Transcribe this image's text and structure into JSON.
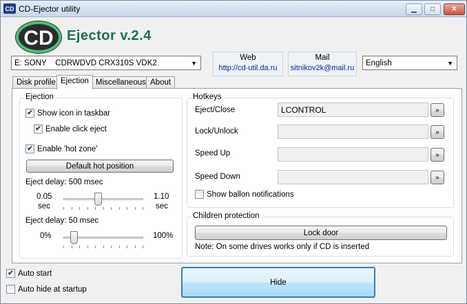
{
  "window": {
    "icon_text": "CD",
    "title": "CD-Ejector utility",
    "minimize_glyph": "▁",
    "maximize_glyph": "□",
    "close_glyph": "✕"
  },
  "header": {
    "logo_text": "CD",
    "brand": "Ejector v.2.4",
    "logo_colors": {
      "ring": "#4cc07a",
      "letters": "#ffffff",
      "disc": "#2c2c2c"
    }
  },
  "drive_select": {
    "value": "E: SONY    CDRWDVD CRX310S VDK2"
  },
  "web": {
    "label": "Web",
    "url": "http://cd-util.da.ru"
  },
  "mail": {
    "label": "Mail",
    "address": "sitnikov2k@mail.ru"
  },
  "language_select": {
    "value": "English"
  },
  "tabs": [
    {
      "label": "Disk profile"
    },
    {
      "label": "Ejection"
    },
    {
      "label": "Miscellaneous"
    },
    {
      "label": "About"
    }
  ],
  "ejection": {
    "title": "Ejection",
    "show_icon": {
      "label": "Show icon in taskbar",
      "checked": true
    },
    "enable_click": {
      "label": "Enable click eject",
      "checked": true
    },
    "hot_zone": {
      "label": "Enable 'hot zone'",
      "checked": true
    },
    "default_hot_button": "Default hot position",
    "delay1": {
      "label": "Eject delay: 500 msec",
      "min_value": "0.05",
      "min_unit": "sec",
      "max_value": "1.10",
      "max_unit": "sec",
      "position": 0.43
    },
    "delay2": {
      "label": "Eject delay: 50 msec",
      "min_label": "0%",
      "max_label": "100%",
      "position": 0.13
    }
  },
  "hotkeys": {
    "title": "Hotkeys",
    "rows": [
      {
        "label": "Eject/Close",
        "value": "LCONTROL",
        "button": "»"
      },
      {
        "label": "Lock/Unlock",
        "value": "",
        "button": "»"
      },
      {
        "label": "Speed Up",
        "value": "",
        "button": "»"
      },
      {
        "label": "Speed Down",
        "value": "",
        "button": "»"
      }
    ],
    "show_ballon": {
      "label": "Show ballon notifications",
      "checked": false
    }
  },
  "children": {
    "title": "Children protection",
    "lock_button": "Lock door",
    "note": "Note: On some drives works only if CD is inserted"
  },
  "footer": {
    "auto_start": {
      "label": "Auto start",
      "checked": true
    },
    "auto_hide": {
      "label": "Auto hide at startup",
      "checked": false
    },
    "hide_button": "Hide"
  }
}
